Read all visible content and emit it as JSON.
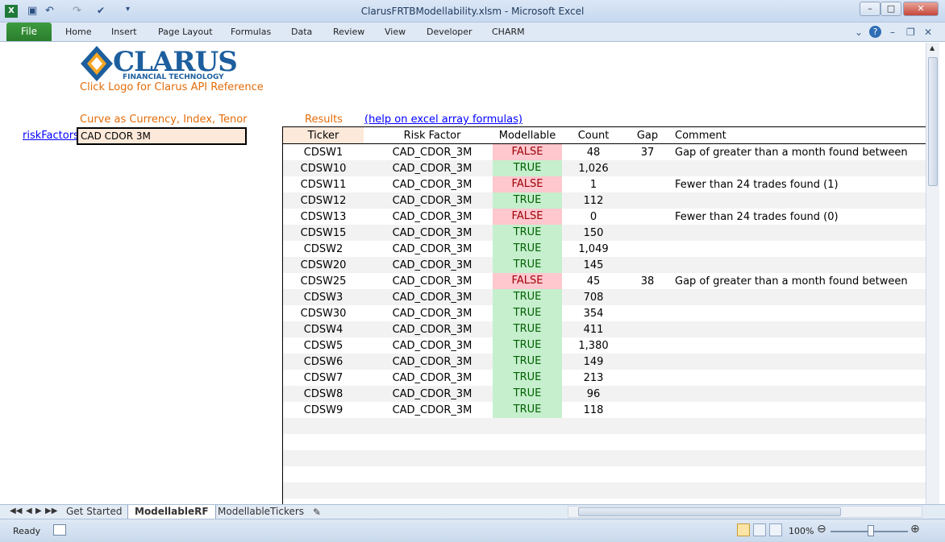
{
  "window": {
    "title": "ClarusFRTBModellability.xlsm  -  Microsoft Excel"
  },
  "ribbon": {
    "file_label": "File",
    "tabs": [
      "Home",
      "Insert",
      "Page Layout",
      "Formulas",
      "Data",
      "Review",
      "View",
      "Developer",
      "CHARM"
    ]
  },
  "sheet": {
    "logo_text": "CLARUS",
    "logo_sub": "FINANCIAL TECHNOLOGY",
    "logo_link": "Click Logo for Clarus API Reference",
    "curve_label": "Curve as Currency, Index, Tenor",
    "risk_factors_label": "riskFactors",
    "risk_factors_value": "CAD CDOR 3M",
    "results_label": "Results",
    "help_link": "(help on excel array formulas)",
    "table": {
      "headers": {
        "ticker": "Ticker",
        "risk_factor": "Risk Factor",
        "modellable": "Modellable",
        "count": "Count",
        "gap": "Gap",
        "comment": "Comment"
      },
      "rows": [
        {
          "ticker": "CDSW1",
          "risk_factor": "CAD_CDOR_3M",
          "modellable": "FALSE",
          "count": "48",
          "gap": "37",
          "comment": "Gap of greater than a month found between conse"
        },
        {
          "ticker": "CDSW10",
          "risk_factor": "CAD_CDOR_3M",
          "modellable": "TRUE",
          "count": "1,026",
          "gap": "",
          "comment": ""
        },
        {
          "ticker": "CDSW11",
          "risk_factor": "CAD_CDOR_3M",
          "modellable": "FALSE",
          "count": "1",
          "gap": "",
          "comment": "Fewer than 24 trades found (1)"
        },
        {
          "ticker": "CDSW12",
          "risk_factor": "CAD_CDOR_3M",
          "modellable": "TRUE",
          "count": "112",
          "gap": "",
          "comment": ""
        },
        {
          "ticker": "CDSW13",
          "risk_factor": "CAD_CDOR_3M",
          "modellable": "FALSE",
          "count": "0",
          "gap": "",
          "comment": "Fewer than 24 trades found (0)"
        },
        {
          "ticker": "CDSW15",
          "risk_factor": "CAD_CDOR_3M",
          "modellable": "TRUE",
          "count": "150",
          "gap": "",
          "comment": ""
        },
        {
          "ticker": "CDSW2",
          "risk_factor": "CAD_CDOR_3M",
          "modellable": "TRUE",
          "count": "1,049",
          "gap": "",
          "comment": ""
        },
        {
          "ticker": "CDSW20",
          "risk_factor": "CAD_CDOR_3M",
          "modellable": "TRUE",
          "count": "145",
          "gap": "",
          "comment": ""
        },
        {
          "ticker": "CDSW25",
          "risk_factor": "CAD_CDOR_3M",
          "modellable": "FALSE",
          "count": "45",
          "gap": "38",
          "comment": "Gap of greater than a month found between conse"
        },
        {
          "ticker": "CDSW3",
          "risk_factor": "CAD_CDOR_3M",
          "modellable": "TRUE",
          "count": "708",
          "gap": "",
          "comment": ""
        },
        {
          "ticker": "CDSW30",
          "risk_factor": "CAD_CDOR_3M",
          "modellable": "TRUE",
          "count": "354",
          "gap": "",
          "comment": ""
        },
        {
          "ticker": "CDSW4",
          "risk_factor": "CAD_CDOR_3M",
          "modellable": "TRUE",
          "count": "411",
          "gap": "",
          "comment": ""
        },
        {
          "ticker": "CDSW5",
          "risk_factor": "CAD_CDOR_3M",
          "modellable": "TRUE",
          "count": "1,380",
          "gap": "",
          "comment": ""
        },
        {
          "ticker": "CDSW6",
          "risk_factor": "CAD_CDOR_3M",
          "modellable": "TRUE",
          "count": "149",
          "gap": "",
          "comment": ""
        },
        {
          "ticker": "CDSW7",
          "risk_factor": "CAD_CDOR_3M",
          "modellable": "TRUE",
          "count": "213",
          "gap": "",
          "comment": ""
        },
        {
          "ticker": "CDSW8",
          "risk_factor": "CAD_CDOR_3M",
          "modellable": "TRUE",
          "count": "96",
          "gap": "",
          "comment": ""
        },
        {
          "ticker": "CDSW9",
          "risk_factor": "CAD_CDOR_3M",
          "modellable": "TRUE",
          "count": "118",
          "gap": "",
          "comment": ""
        }
      ]
    }
  },
  "sheet_tabs": [
    "Get Started",
    "ModellableRF",
    "ModellableTickers"
  ],
  "active_sheet": "ModellableRF",
  "status": {
    "ready": "Ready",
    "zoom": "100%"
  },
  "colors": {
    "false_bg": "#ffc7ce",
    "false_fg": "#9c0006",
    "true_bg": "#c6efce",
    "true_fg": "#006100",
    "accent": "#e36c09"
  }
}
